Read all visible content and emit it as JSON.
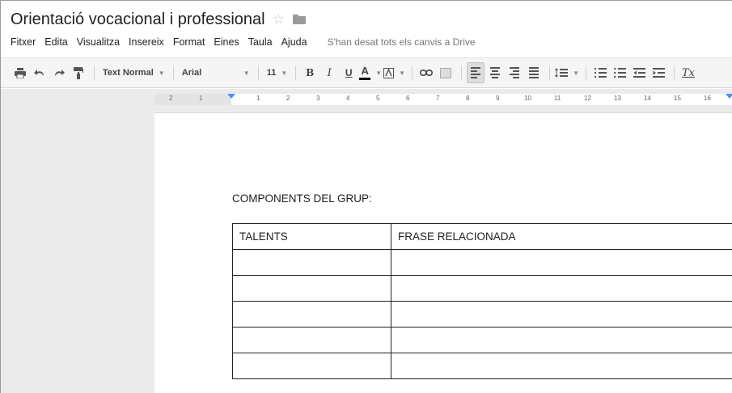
{
  "document": {
    "title": "Orientació vocacional i professional",
    "save_status": "S'han desat tots els canvis a Drive"
  },
  "menu": [
    "Fitxer",
    "Edita",
    "Visualitza",
    "Insereix",
    "Format",
    "Eines",
    "Taula",
    "Ajuda"
  ],
  "toolbar": {
    "style_select": "Text Normal",
    "font_select": "Arial",
    "size_select": "11",
    "bold": "B",
    "italic": "I",
    "underline": "U",
    "text_color": "A",
    "clear_format": "Tx"
  },
  "ruler": {
    "left_ticks": [
      "2",
      "1"
    ],
    "ticks": [
      "1",
      "2",
      "3",
      "4",
      "5",
      "6",
      "7",
      "8",
      "9",
      "10",
      "11",
      "12",
      "13",
      "14",
      "15",
      "16"
    ]
  },
  "content": {
    "heading": "COMPONENTS DEL GRUP:",
    "table": {
      "headers": [
        "TALENTS",
        "FRASE RELACIONADA"
      ],
      "rows": [
        [
          "",
          ""
        ],
        [
          "",
          ""
        ],
        [
          "",
          ""
        ],
        [
          "",
          ""
        ],
        [
          "",
          ""
        ]
      ]
    }
  },
  "colors": {
    "toolbar_bg": "#f5f5f5",
    "page_bg": "#ffffff",
    "gutter_bg": "#ebebeb",
    "ruler_marker": "#4d90fe"
  }
}
